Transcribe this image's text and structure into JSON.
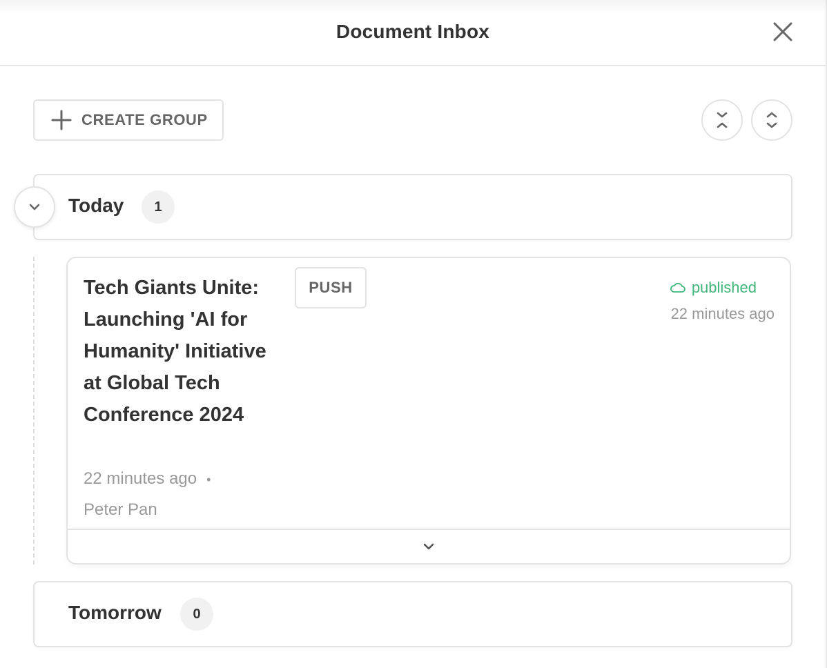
{
  "header": {
    "title": "Document Inbox",
    "close_icon": "close-icon"
  },
  "toolbar": {
    "create_group_label": "CREATE GROUP",
    "create_group_icon": "plus-icon",
    "collapse_all_icon": "collapse-all-icon",
    "expand_all_icon": "expand-all-icon"
  },
  "groups": [
    {
      "label": "Today",
      "count": "1",
      "expanded": true,
      "items": [
        {
          "title": "Tech Giants Unite: Launching 'AI for Humanity' Initiative at Global Tech Conference 2024",
          "badge": "PUSH",
          "created": "22 minutes ago",
          "separator": "•",
          "author": "Peter Pan",
          "status": "published",
          "status_icon": "cloud-icon",
          "status_time": "22 minutes ago"
        }
      ]
    },
    {
      "label": "Tomorrow",
      "count": "0",
      "expanded": false,
      "items": []
    }
  ],
  "colors": {
    "status_published": "#3fb67a",
    "text_primary": "#333333",
    "text_muted": "#999999",
    "border": "#e3e3e3",
    "badge_bg": "#f1f1f1"
  }
}
